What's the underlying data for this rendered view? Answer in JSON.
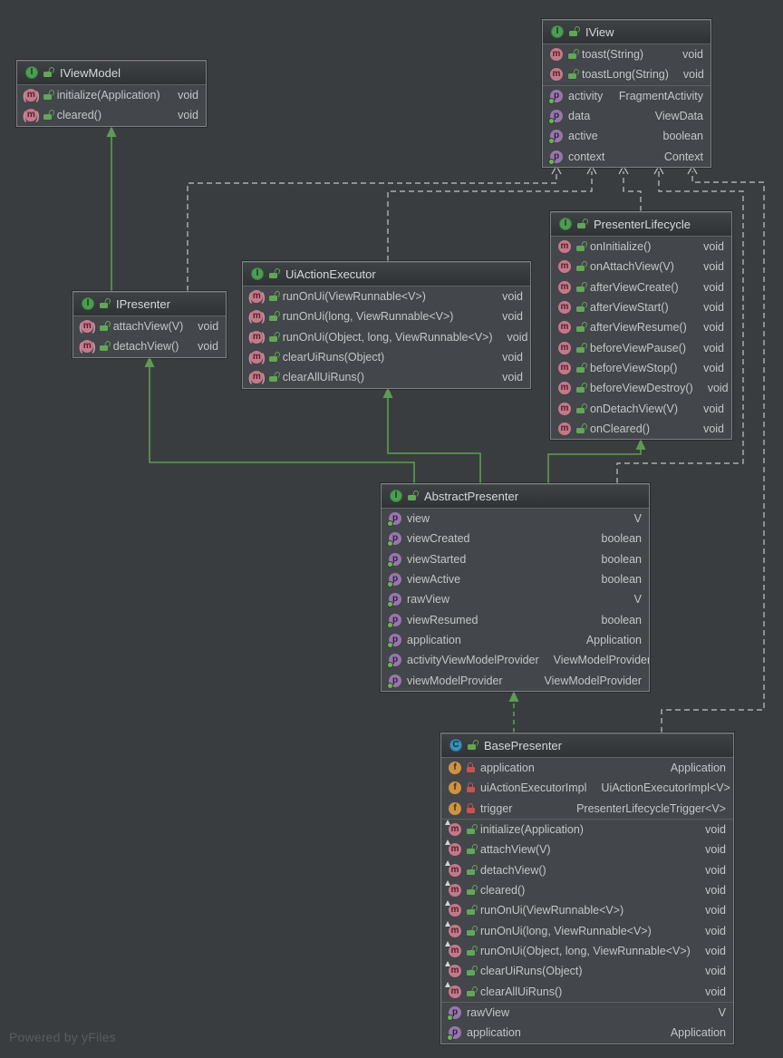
{
  "canvas": {
    "watermark": "Powered by yFiles",
    "background": "#3A3D40"
  },
  "colors": {
    "node_body": "#43464A",
    "node_header": "#36393C",
    "node_border": "#7E8082",
    "inheritance_edge": "#5C9C52",
    "dependency_edge": "#C2C4C6",
    "label_text": "#C4C6C8",
    "title_text": "#D6D8DA",
    "interface_icon": "#4C9E53",
    "class_icon": "#3F8FB8",
    "method_icon": "#C4798A",
    "property_icon": "#9876AA",
    "field_icon": "#CE9342",
    "public_lock": "#62A757",
    "private_lock": "#C75450"
  },
  "classes": [
    {
      "id": "IViewModel",
      "kind": "interface",
      "name": "IViewModel",
      "sections": [
        {
          "type": "methods",
          "rows": [
            {
              "icon": "abstract-method-icon",
              "lock": "public",
              "label": "initialize(Application)",
              "type": "void"
            },
            {
              "icon": "abstract-method-icon",
              "lock": "public",
              "label": "cleared()",
              "type": "void"
            }
          ]
        }
      ]
    },
    {
      "id": "IView",
      "kind": "interface",
      "name": "IView",
      "sections": [
        {
          "type": "methods",
          "rows": [
            {
              "icon": "method-icon",
              "lock": "public",
              "label": "toast(String)",
              "type": "void"
            },
            {
              "icon": "method-icon",
              "lock": "public",
              "label": "toastLong(String)",
              "type": "void"
            }
          ]
        },
        {
          "type": "properties",
          "rows": [
            {
              "icon": "property-icon",
              "lock": null,
              "label": "activity",
              "type": "FragmentActivity"
            },
            {
              "icon": "property-icon",
              "lock": null,
              "label": "data",
              "type": "ViewData"
            },
            {
              "icon": "property-icon",
              "lock": null,
              "label": "active",
              "type": "boolean"
            },
            {
              "icon": "property-icon",
              "lock": null,
              "label": "context",
              "type": "Context"
            }
          ]
        }
      ]
    },
    {
      "id": "IPresenter",
      "kind": "interface",
      "name": "IPresenter",
      "sections": [
        {
          "type": "methods",
          "rows": [
            {
              "icon": "abstract-method-icon",
              "lock": "public",
              "label": "attachView(V)",
              "type": "void"
            },
            {
              "icon": "abstract-method-icon",
              "lock": "public",
              "label": "detachView()",
              "type": "void"
            }
          ]
        }
      ]
    },
    {
      "id": "UiActionExecutor",
      "kind": "interface",
      "name": "UiActionExecutor",
      "sections": [
        {
          "type": "methods",
          "rows": [
            {
              "icon": "abstract-method-icon",
              "lock": "public",
              "label": "runOnUi(ViewRunnable<V>)",
              "type": "void"
            },
            {
              "icon": "abstract-method-icon",
              "lock": "public",
              "label": "runOnUi(long, ViewRunnable<V>)",
              "type": "void"
            },
            {
              "icon": "abstract-method-icon",
              "lock": "public",
              "label": "runOnUi(Object, long, ViewRunnable<V>)",
              "type": "void"
            },
            {
              "icon": "abstract-method-icon",
              "lock": "public",
              "label": "clearUiRuns(Object)",
              "type": "void"
            },
            {
              "icon": "abstract-method-icon",
              "lock": "public",
              "label": "clearAllUiRuns()",
              "type": "void"
            }
          ]
        }
      ]
    },
    {
      "id": "PresenterLifecycle",
      "kind": "interface",
      "name": "PresenterLifecycle",
      "sections": [
        {
          "type": "methods",
          "rows": [
            {
              "icon": "method-icon",
              "lock": "public",
              "label": "onInitialize()",
              "type": "void"
            },
            {
              "icon": "method-icon",
              "lock": "public",
              "label": "onAttachView(V)",
              "type": "void"
            },
            {
              "icon": "method-icon",
              "lock": "public",
              "label": "afterViewCreate()",
              "type": "void"
            },
            {
              "icon": "method-icon",
              "lock": "public",
              "label": "afterViewStart()",
              "type": "void"
            },
            {
              "icon": "method-icon",
              "lock": "public",
              "label": "afterViewResume()",
              "type": "void"
            },
            {
              "icon": "method-icon",
              "lock": "public",
              "label": "beforeViewPause()",
              "type": "void"
            },
            {
              "icon": "method-icon",
              "lock": "public",
              "label": "beforeViewStop()",
              "type": "void"
            },
            {
              "icon": "method-icon",
              "lock": "public",
              "label": "beforeViewDestroy()",
              "type": "void"
            },
            {
              "icon": "method-icon",
              "lock": "public",
              "label": "onDetachView(V)",
              "type": "void"
            },
            {
              "icon": "method-icon",
              "lock": "public",
              "label": "onCleared()",
              "type": "void"
            }
          ]
        }
      ]
    },
    {
      "id": "AbstractPresenter",
      "kind": "interface",
      "name": "AbstractPresenter",
      "sections": [
        {
          "type": "properties",
          "rows": [
            {
              "icon": "property-icon",
              "lock": null,
              "label": "view",
              "type": "V"
            },
            {
              "icon": "property-icon",
              "lock": null,
              "label": "viewCreated",
              "type": "boolean"
            },
            {
              "icon": "property-icon",
              "lock": null,
              "label": "viewStarted",
              "type": "boolean"
            },
            {
              "icon": "property-icon",
              "lock": null,
              "label": "viewActive",
              "type": "boolean"
            },
            {
              "icon": "property-icon",
              "lock": null,
              "label": "rawView",
              "type": "V"
            },
            {
              "icon": "property-icon",
              "lock": null,
              "label": "viewResumed",
              "type": "boolean"
            },
            {
              "icon": "property-icon",
              "lock": null,
              "label": "application",
              "type": "Application"
            },
            {
              "icon": "property-icon",
              "lock": null,
              "label": "activityViewModelProvider",
              "type": "ViewModelProvider"
            },
            {
              "icon": "property-icon",
              "lock": null,
              "label": "viewModelProvider",
              "type": "ViewModelProvider"
            }
          ]
        }
      ]
    },
    {
      "id": "BasePresenter",
      "kind": "class",
      "name": "BasePresenter",
      "sections": [
        {
          "type": "fields",
          "rows": [
            {
              "icon": "field-icon",
              "lock": "private",
              "label": "application",
              "type": "Application"
            },
            {
              "icon": "field-icon",
              "lock": "private",
              "label": "uiActionExecutorImpl",
              "type": "UiActionExecutorImpl<V>"
            },
            {
              "icon": "field-icon",
              "lock": "private",
              "label": "trigger",
              "type": "PresenterLifecycleTrigger<V>"
            }
          ]
        },
        {
          "type": "methods",
          "rows": [
            {
              "icon": "override-method-icon",
              "lock": "public",
              "label": "initialize(Application)",
              "type": "void"
            },
            {
              "icon": "override-method-icon",
              "lock": "public",
              "label": "attachView(V)",
              "type": "void"
            },
            {
              "icon": "override-method-icon",
              "lock": "public",
              "label": "detachView()",
              "type": "void"
            },
            {
              "icon": "override-method-icon",
              "lock": "public",
              "label": "cleared()",
              "type": "void"
            },
            {
              "icon": "override-method-icon",
              "lock": "public",
              "label": "runOnUi(ViewRunnable<V>)",
              "type": "void"
            },
            {
              "icon": "override-method-icon",
              "lock": "public",
              "label": "runOnUi(long, ViewRunnable<V>)",
              "type": "void"
            },
            {
              "icon": "override-method-icon",
              "lock": "public",
              "label": "runOnUi(Object, long, ViewRunnable<V>)",
              "type": "void"
            },
            {
              "icon": "override-method-icon",
              "lock": "public",
              "label": "clearUiRuns(Object)",
              "type": "void"
            },
            {
              "icon": "override-method-icon",
              "lock": "public",
              "label": "clearAllUiRuns()",
              "type": "void"
            }
          ]
        },
        {
          "type": "properties",
          "rows": [
            {
              "icon": "property-icon",
              "lock": null,
              "label": "rawView",
              "type": "V"
            },
            {
              "icon": "property-icon",
              "lock": null,
              "label": "application",
              "type": "Application"
            }
          ]
        }
      ]
    }
  ],
  "edges": [
    {
      "from": "IPresenter",
      "to": "IViewModel",
      "type": "extends"
    },
    {
      "from": "AbstractPresenter",
      "to": "IPresenter",
      "type": "extends"
    },
    {
      "from": "AbstractPresenter",
      "to": "UiActionExecutor",
      "type": "extends"
    },
    {
      "from": "AbstractPresenter",
      "to": "PresenterLifecycle",
      "type": "extends"
    },
    {
      "from": "BasePresenter",
      "to": "AbstractPresenter",
      "type": "implements"
    },
    {
      "from": "IPresenter",
      "to": "IView",
      "type": "dependency"
    },
    {
      "from": "UiActionExecutor",
      "to": "IView",
      "type": "dependency"
    },
    {
      "from": "PresenterLifecycle",
      "to": "IView",
      "type": "dependency"
    },
    {
      "from": "AbstractPresenter",
      "to": "IView",
      "type": "dependency"
    },
    {
      "from": "BasePresenter",
      "to": "IView",
      "type": "dependency"
    }
  ]
}
